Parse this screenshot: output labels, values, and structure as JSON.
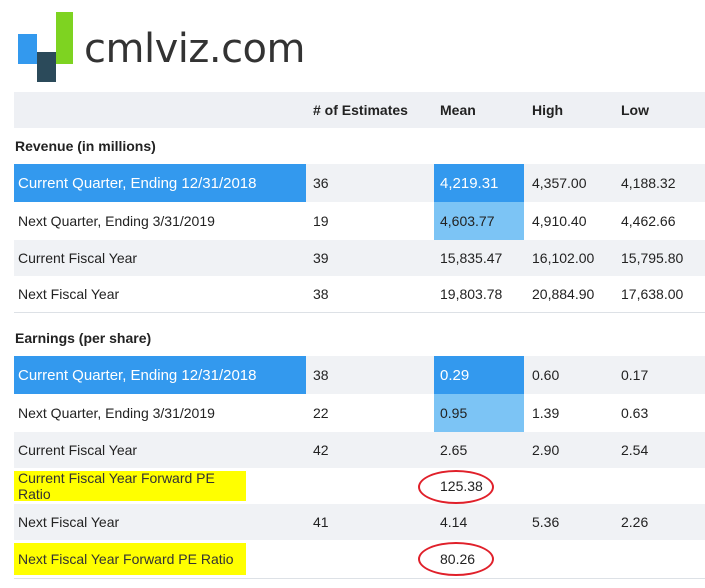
{
  "logo": {
    "text": "cmlviz.com"
  },
  "columns": {
    "label": "",
    "estimates": "# of Estimates",
    "mean": "Mean",
    "high": "High",
    "low": "Low"
  },
  "revenue": {
    "title": "Revenue (in millions)",
    "rows": [
      {
        "label": "Current Quarter, Ending 12/31/2018",
        "estimates": "36",
        "mean": "4,219.31",
        "high": "4,357.00",
        "low": "4,188.32"
      },
      {
        "label": "Next Quarter, Ending 3/31/2019",
        "estimates": "19",
        "mean": "4,603.77",
        "high": "4,910.40",
        "low": "4,462.66"
      },
      {
        "label": "Current Fiscal Year",
        "estimates": "39",
        "mean": "15,835.47",
        "high": "16,102.00",
        "low": "15,795.80"
      },
      {
        "label": "Next Fiscal Year",
        "estimates": "38",
        "mean": "19,803.78",
        "high": "20,884.90",
        "low": "17,638.00"
      }
    ]
  },
  "earnings": {
    "title": "Earnings (per share)",
    "rows": [
      {
        "label": "Current Quarter, Ending 12/31/2018",
        "estimates": "38",
        "mean": "0.29",
        "high": "0.60",
        "low": "0.17"
      },
      {
        "label": "Next Quarter, Ending 3/31/2019",
        "estimates": "22",
        "mean": "0.95",
        "high": "1.39",
        "low": "0.63"
      },
      {
        "label": "Current Fiscal Year",
        "estimates": "42",
        "mean": "2.65",
        "high": "2.90",
        "low": "2.54"
      },
      {
        "label": "Current Fiscal Year Forward PE Ratio",
        "estimates": "",
        "mean": "125.38",
        "high": "",
        "low": ""
      },
      {
        "label": "Next Fiscal Year",
        "estimates": "41",
        "mean": "4.14",
        "high": "5.36",
        "low": "2.26"
      },
      {
        "label": "Next Fiscal Year Forward PE Ratio",
        "estimates": "",
        "mean": "80.26",
        "high": "",
        "low": ""
      }
    ]
  },
  "colors": {
    "highlight_dark": "#3399ee",
    "highlight_light": "#7cc4f5",
    "pe_highlight": "#ffff00",
    "circle": "#e0202a"
  }
}
